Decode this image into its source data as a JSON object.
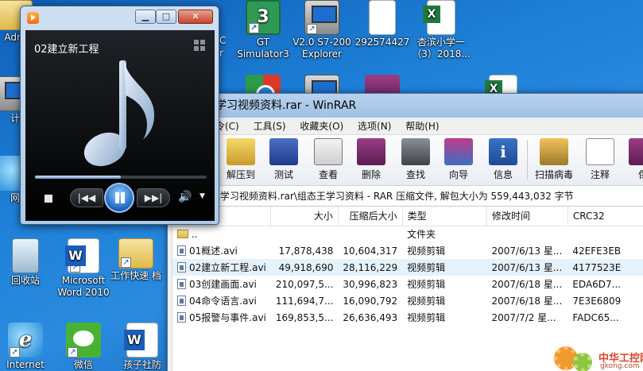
{
  "desktop": {
    "icons": [
      {
        "label": "Adm"
      },
      {
        "label": "GT Simulator3"
      },
      {
        "label": "V2.0 S7-200 Explorer"
      },
      {
        "label": "292574427"
      },
      {
        "label": "杏滨小学一（3）2018..."
      },
      {
        "label": "计"
      },
      {
        "label": "网"
      },
      {
        "label": "回收站"
      },
      {
        "label": "Microsoft Word 2010"
      },
      {
        "label": "工作快速 档"
      },
      {
        "label": "Internet"
      },
      {
        "label": "微信"
      },
      {
        "label": "孩子社防"
      }
    ],
    "partial_labels": {
      "left_c": "C",
      "left_r": "r"
    }
  },
  "media_player": {
    "track_title": "02建立新工程",
    "window_buttons": {
      "minimize": "▁",
      "maximize": "□",
      "close": "✕"
    },
    "seek_progress_fraction": 0.5,
    "controls": {
      "prev": "|◀◀",
      "next": "▶▶|",
      "volume": "🔊",
      "menu": "▼"
    }
  },
  "winrar": {
    "title": "学习视频资料.rar - WinRAR",
    "menu": [
      "令(C)",
      "工具(S)",
      "收藏夹(O)",
      "选项(N)",
      "帮助(H)"
    ],
    "toolbar": [
      {
        "label": "解压到",
        "icon": "extract-icon"
      },
      {
        "label": "测试",
        "icon": "test-icon"
      },
      {
        "label": "查看",
        "icon": "view-icon"
      },
      {
        "label": "删除",
        "icon": "delete-icon"
      },
      {
        "label": "查找",
        "icon": "find-icon"
      },
      {
        "label": "向导",
        "icon": "wizard-icon"
      },
      {
        "label": "信息",
        "icon": "info-icon"
      },
      {
        "label": "扫描病毒",
        "icon": "virus-scan-icon"
      },
      {
        "label": "注释",
        "icon": "comment-icon"
      },
      {
        "label": "保",
        "icon": "protect-icon"
      }
    ],
    "path": "组态王学习视频资料.rar\\组态王学习资料 - RAR 压缩文件, 解包大小为 559,443,032 字节",
    "columns": [
      "",
      "大小",
      "压缩后大小",
      "类型",
      "修改时间",
      "CRC32"
    ],
    "rows": [
      {
        "name": "..",
        "size": "",
        "packed": "",
        "type": "文件夹",
        "modified": "",
        "crc": "",
        "folder": true
      },
      {
        "name": "01概述.avi",
        "size": "17,878,438",
        "packed": "10,604,317",
        "type": "视频剪辑",
        "modified": "2007/6/13 星...",
        "crc": "42EFE3EB"
      },
      {
        "name": "02建立新工程.avi",
        "size": "49,918,690",
        "packed": "28,116,229",
        "type": "视频剪辑",
        "modified": "2007/6/13 星...",
        "crc": "4177523E",
        "selected": true
      },
      {
        "name": "03创建画面.avi",
        "size": "210,097,5...",
        "packed": "30,996,823",
        "type": "视频剪辑",
        "modified": "2007/6/18 星...",
        "crc": "EDA6D7..."
      },
      {
        "name": "04命令语言.avi",
        "size": "111,694,7...",
        "packed": "16,090,792",
        "type": "视频剪辑",
        "modified": "2007/6/18 星...",
        "crc": "7E3E6809"
      },
      {
        "name": "05报警与事件.avi",
        "size": "169,853,5...",
        "packed": "26,636,493",
        "type": "视频剪辑",
        "modified": "2007/7/2 星...",
        "crc": "FADC65..."
      }
    ]
  },
  "watermark": {
    "text": "中华工控网",
    "sub": "gkong.com"
  }
}
